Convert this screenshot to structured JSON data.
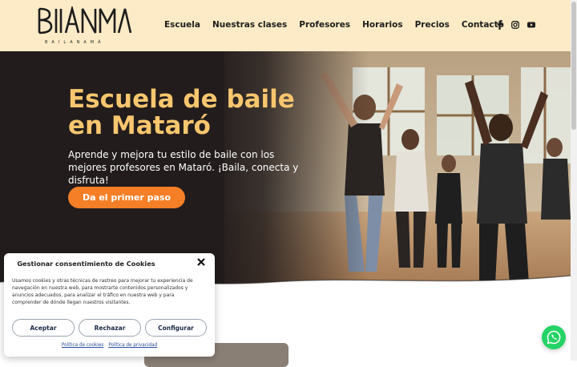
{
  "brand": {
    "logo_text": "BIANMA",
    "subtitle": "BAILANAMÁ"
  },
  "nav": {
    "items": [
      {
        "label": "Escuela"
      },
      {
        "label": "Nuestras clases"
      },
      {
        "label": "Profesores"
      },
      {
        "label": "Horarios"
      },
      {
        "label": "Precios"
      },
      {
        "label": "Contacto"
      }
    ]
  },
  "social": {
    "icons": [
      "facebook-icon",
      "instagram-icon",
      "youtube-icon"
    ]
  },
  "hero": {
    "title_line1": "Escuela de baile",
    "title_line2": "en Mataró",
    "subtitle": "Aprende y mejora tu estilo de baile con los mejores profesores en Mataró.  ¡Baila, conecta y disfruta!",
    "cta_label": "Da el primer paso"
  },
  "cookies": {
    "title": "Gestionar consentimiento de Cookies",
    "text": "Usamos cookies y otras técnicas de rastreo para mejorar tu experiencia de navegación en nuestra web, para mostrarte contenidos personalizados y anuncios adecuados, para analizar el tráfico en nuestra web y para comprender de dónde llegan nuestros visitantes.",
    "accept_label": "Aceptar",
    "reject_label": "Rechazar",
    "configure_label": "Configurar",
    "link_cookies": "Política de cookies",
    "link_privacy": "Política de privacidad"
  },
  "colors": {
    "header_bg": "#fdebc7",
    "accent": "#f57f27",
    "title": "#f7c66e",
    "hero_bg": "#221c1c",
    "whatsapp": "#25d366"
  }
}
